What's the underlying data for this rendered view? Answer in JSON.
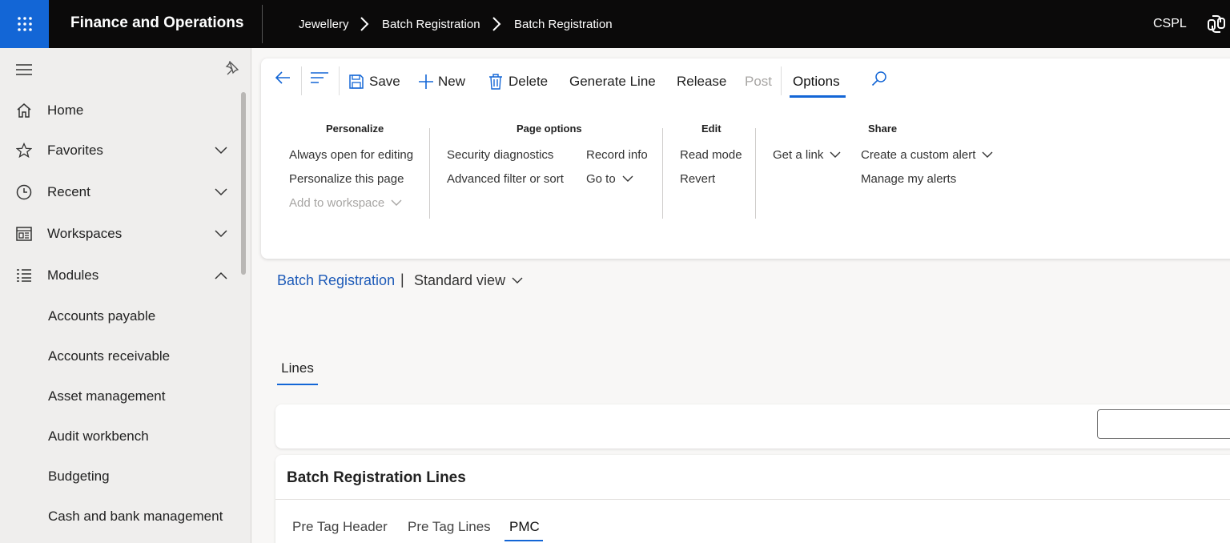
{
  "topbar": {
    "app_title": "Finance and Operations",
    "breadcrumbs": [
      "Jewellery",
      "Batch Registration",
      "Batch Registration"
    ],
    "company": "CSPL",
    "icons": [
      "waffle-icon",
      "chevron-right-icon",
      "copilot-icon"
    ]
  },
  "nav": {
    "items": [
      {
        "label": "Home",
        "icon": "home-icon"
      },
      {
        "label": "Favorites",
        "icon": "star-icon"
      },
      {
        "label": "Recent",
        "icon": "clock-icon"
      },
      {
        "label": "Workspaces",
        "icon": "workspace-icon"
      },
      {
        "label": "Modules",
        "icon": "list-icon"
      }
    ],
    "modules": [
      "Accounts payable",
      "Accounts receivable",
      "Asset management",
      "Audit workbench",
      "Budgeting",
      "Cash and bank management"
    ]
  },
  "actionpane": {
    "save": "Save",
    "new": "New",
    "delete": "Delete",
    "generate_line": "Generate Line",
    "release": "Release",
    "post": "Post",
    "options": "Options",
    "groups": {
      "personalize": {
        "title": "Personalize",
        "items": [
          "Always open for editing",
          "Personalize this page",
          "Add to workspace"
        ]
      },
      "page_options": {
        "title": "Page options",
        "items": [
          "Security diagnostics",
          "Advanced filter or sort",
          "Record info",
          "Go to"
        ]
      },
      "edit": {
        "title": "Edit",
        "items": [
          "Read mode",
          "Revert"
        ]
      },
      "share": {
        "title": "Share",
        "items": [
          "Get a link",
          "Create a custom alert",
          "Manage my alerts"
        ]
      }
    }
  },
  "page": {
    "title_link": "Batch Registration",
    "separator": "|",
    "view": "Standard view",
    "tab": "Lines",
    "lines_title": "Batch Registration Lines",
    "sub_tabs": [
      "Pre Tag Header",
      "Pre Tag Lines",
      "PMC"
    ]
  },
  "colors": {
    "accent": "#1366d6",
    "topbar_bg": "#0b0a0a",
    "link": "#1e5bb8"
  }
}
